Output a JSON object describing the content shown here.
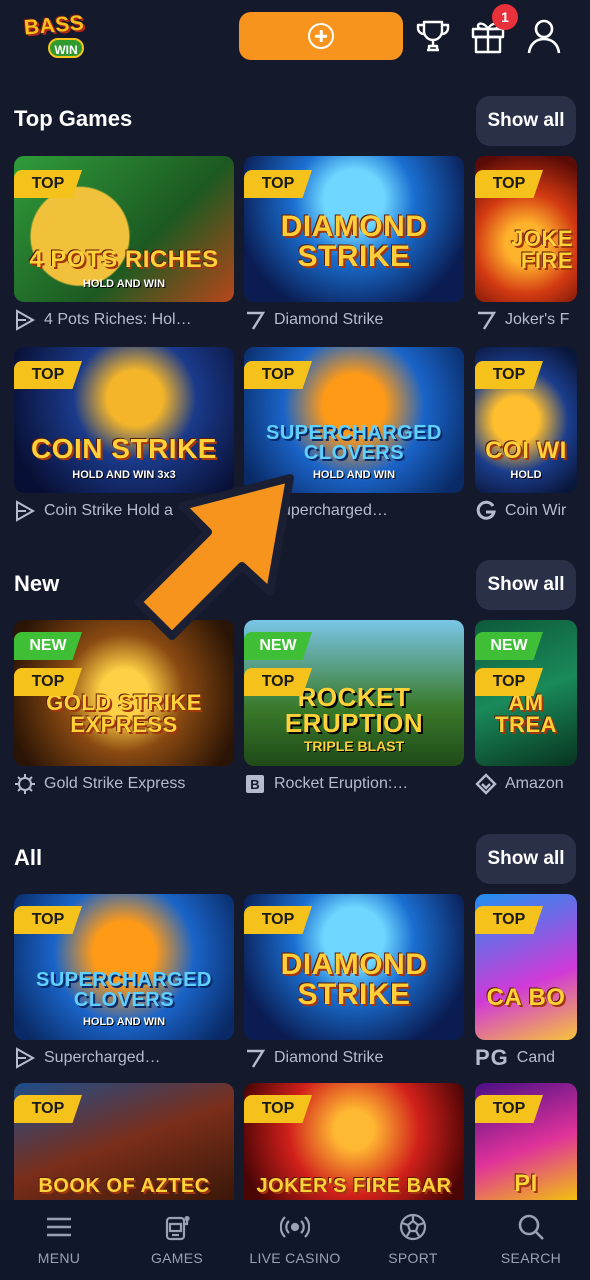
{
  "header": {
    "logo_line1": "BASS",
    "logo_line2": "WIN",
    "notification_count": "1"
  },
  "sections": {
    "top_games": {
      "title": "Top Games",
      "show_all": "Show all",
      "row1": [
        {
          "caption": "4 Pots Riches: Hol…",
          "tag": "TOP",
          "art_title": "4 POTS RICHES",
          "art_sub": "HOLD AND WIN"
        },
        {
          "caption": "Diamond Strike",
          "tag": "TOP",
          "art_title": "DIAMOND STRIKE",
          "art_sub": ""
        },
        {
          "caption": "Joker's F",
          "tag": "TOP",
          "art_title": "JOKE FIRE",
          "art_sub": ""
        }
      ],
      "row2": [
        {
          "caption": "Coin Strike Hold a",
          "tag": "TOP",
          "art_title": "COIN STRIKE",
          "art_sub": "HOLD AND WIN 3x3"
        },
        {
          "caption": "upercharged…",
          "tag": "TOP",
          "art_title": "SUPERCHARGED CLOVERS",
          "art_sub": "HOLD AND WIN"
        },
        {
          "caption": "Coin Wir",
          "tag": "TOP",
          "art_title": "COI WI",
          "art_sub": "HOLD"
        }
      ]
    },
    "new": {
      "title": "New",
      "show_all": "Show all",
      "row": [
        {
          "caption": "Gold Strike Express",
          "tag_new": "NEW",
          "tag": "TOP",
          "art_title": "GOLD STRIKE EXPRESS",
          "art_sub": ""
        },
        {
          "caption": "Rocket Eruption:…",
          "tag_new": "NEW",
          "tag": "TOP",
          "art_title": "ROCKET ERUPTION",
          "art_sub": "TRIPLE BLAST"
        },
        {
          "caption": "Amazon",
          "tag_new": "NEW",
          "tag": "TOP",
          "art_title": "AM TREA",
          "art_sub": ""
        }
      ]
    },
    "all": {
      "title": "All",
      "show_all": "Show all",
      "row1": [
        {
          "caption": "Supercharged…",
          "tag": "TOP",
          "art_title": "SUPERCHARGED CLOVERS",
          "art_sub": "HOLD AND WIN"
        },
        {
          "caption": "Diamond Strike",
          "tag": "TOP",
          "art_title": "DIAMOND STRIKE",
          "art_sub": ""
        },
        {
          "caption": "Cand",
          "tag": "TOP",
          "art_title": "CA BO",
          "art_sub": ""
        }
      ],
      "row2": [
        {
          "tag": "TOP",
          "art_title": "BOOK OF AZTEC",
          "art_sub": ""
        },
        {
          "tag": "TOP",
          "art_title": "JOKER'S FIRE BAR",
          "art_sub": ""
        },
        {
          "tag": "TOP",
          "art_title": "PI",
          "art_sub": ""
        }
      ]
    }
  },
  "providers": {
    "all_row1_third_logo": "PG"
  },
  "bottom_nav": [
    {
      "label": "MENU",
      "icon": "menu-icon"
    },
    {
      "label": "GAMES",
      "icon": "slot-machine-icon"
    },
    {
      "label": "LIVE CASINO",
      "icon": "live-broadcast-icon"
    },
    {
      "label": "SPORT",
      "icon": "soccer-ball-icon"
    },
    {
      "label": "SEARCH",
      "icon": "search-icon"
    }
  ],
  "colors": {
    "background": "#141a2c",
    "accent_orange": "#f7941d",
    "tag_top": "#f5c21c",
    "tag_new": "#3fbf36",
    "badge_red": "#e8313b"
  }
}
